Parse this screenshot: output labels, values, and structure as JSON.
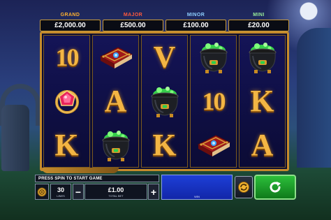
{
  "jackpots": [
    {
      "title": "GRAND",
      "amount": "£2,000.00",
      "color": "#ffb12e"
    },
    {
      "title": "MAJOR",
      "amount": "£500.00",
      "color": "#ff5a3c"
    },
    {
      "title": "MINOR",
      "amount": "£100.00",
      "color": "#8fd0ff"
    },
    {
      "title": "MINI",
      "amount": "£20.00",
      "color": "#9af09a"
    }
  ],
  "reels": [
    [
      "10",
      "ruby-ring",
      "K"
    ],
    [
      "spell-book",
      "A",
      "cauldron"
    ],
    [
      "V",
      "cauldron",
      "K"
    ],
    [
      "cauldron",
      "10",
      "spell-book"
    ],
    [
      "cauldron",
      "K",
      "A"
    ]
  ],
  "controls": {
    "message": "PRESS SPIN TO START GAME",
    "lines_value": "30",
    "lines_label": "LINES",
    "minus_label": "−",
    "plus_label": "+",
    "bet_value": "£1.00",
    "bet_label": "TOTAL BET",
    "win_label": "WIN",
    "win_value": ""
  },
  "icons": {
    "settings": "gear-icon",
    "autoplay": "autoplay-icon",
    "spin": "spin-arrow-icon"
  }
}
